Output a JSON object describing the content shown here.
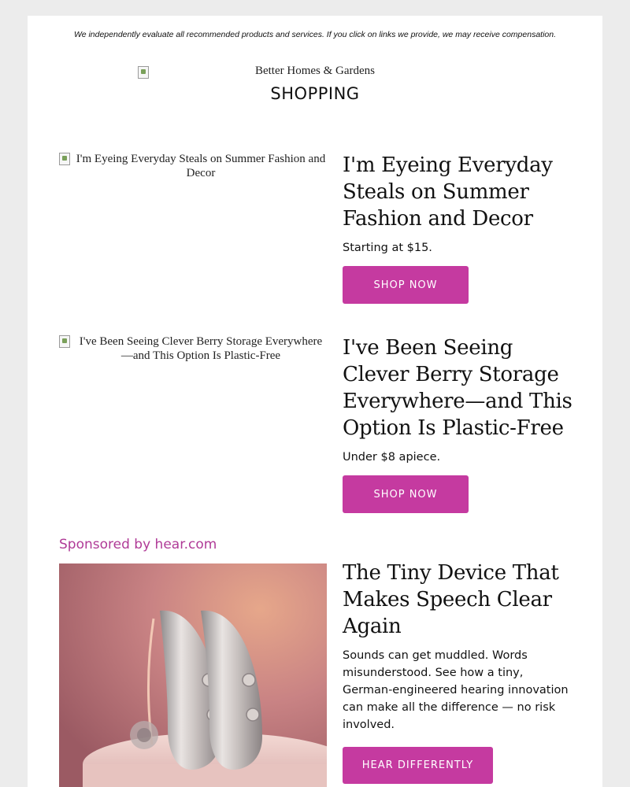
{
  "disclaimer": "We independently evaluate all recommended products and services. If you click on links we provide, we may receive compensation.",
  "header": {
    "brand_alt": "Better Homes & Gardens",
    "section": "SHOPPING"
  },
  "articles": [
    {
      "image_alt": "I'm Eyeing Everyday Steals on Summer Fashion and Decor",
      "title": "I'm Eyeing Everyday Steals on Summer Fashion and Decor",
      "subtitle": "Starting at $15.",
      "button": "SHOP NOW"
    },
    {
      "image_alt": "I've Been Seeing Clever Berry Storage Everywhere—and This Option Is Plastic-Free",
      "title": "I've Been Seeing Clever Berry Storage Everywhere—and This Option Is Plastic-Free",
      "subtitle": "Under $8 apiece.",
      "button": "SHOP NOW"
    }
  ],
  "sponsored": {
    "label": "Sponsored by hear.com",
    "title": "The Tiny Device That Makes Speech Clear Again",
    "body": "Sounds can get muddled. Words misunderstood. See how a tiny, German-engineered hearing innovation can make all the difference — no risk involved.",
    "button": "HEAR DIFFERENTLY",
    "image_icon": "hearing-aids-photo"
  },
  "colors": {
    "accent": "#c53aa0",
    "sponsor_text": "#b03b97",
    "background": "#ececec"
  }
}
